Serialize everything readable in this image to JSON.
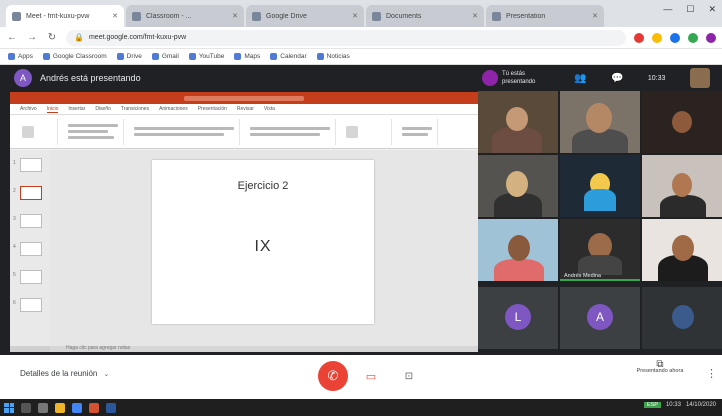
{
  "browser": {
    "tabs": [
      {
        "title": "Meet - fmt-kuxu-pvw",
        "active": true
      },
      {
        "title": "Classroom - ...",
        "active": false
      },
      {
        "title": "Google Drive",
        "active": false
      },
      {
        "title": "Documents",
        "active": false
      },
      {
        "title": "Presentation",
        "active": false
      }
    ],
    "window_controls": {
      "minimize": "—",
      "maximize": "☐",
      "close": "✕"
    },
    "nav": {
      "back": "←",
      "forward": "→",
      "reload": "↻"
    },
    "url": "meet.google.com/fmt-kuxu-pvw",
    "bookmarks": [
      "Apps",
      "Google Classroom",
      "Drive",
      "Gmail",
      "YouTube",
      "Maps",
      "Calendar",
      "Noticias"
    ]
  },
  "meet": {
    "presenter": {
      "initial": "A",
      "title": "Andrés está presentando"
    },
    "self_view": {
      "line1": "Tú estás",
      "line2": "presentando"
    },
    "top_icons": {
      "people": "👥",
      "chat": "💬",
      "time_label": "10:33"
    },
    "presentation": {
      "ribbon_tabs": [
        "Archivo",
        "Inicio",
        "Insertar",
        "Diseño",
        "Transiciones",
        "Animaciones",
        "Presentación",
        "Revisar",
        "Vista"
      ],
      "slide_numbers": [
        "1",
        "2",
        "3",
        "4",
        "5",
        "6"
      ],
      "slide_title": "Ejercicio 2",
      "slide_body": "IX",
      "notes_label": "Haga clic para agregar notas"
    },
    "participants": [
      {
        "label": "",
        "type": "video"
      },
      {
        "label": "",
        "type": "video"
      },
      {
        "label": "",
        "type": "video"
      },
      {
        "label": "",
        "type": "video"
      },
      {
        "label": "",
        "type": "video"
      },
      {
        "label": "",
        "type": "video"
      },
      {
        "label": "",
        "type": "video"
      },
      {
        "label": "Andrés Medina",
        "type": "video",
        "speaking": true
      },
      {
        "label": "",
        "type": "video"
      },
      {
        "label": "",
        "type": "avatar",
        "initial": "L"
      },
      {
        "label": "",
        "type": "avatar",
        "initial": "A"
      },
      {
        "label": "",
        "type": "video"
      }
    ]
  },
  "controls": {
    "details_label": "Detalles de la reunión",
    "details_chevron": "⌄",
    "end_call_icon": "✆",
    "camera_icon": "▭",
    "captions_icon": "⊡",
    "presenting_icon": "⧉",
    "presenting_label": "Presentando ahora",
    "more_icon": "⋮"
  },
  "taskbar": {
    "tray_badge": "ESP",
    "time": "10:33",
    "date": "14/10/2020"
  },
  "colors": {
    "meet_bg": "#202124",
    "end_call": "#ea4335",
    "ppt_accent": "#c43e1c",
    "speaking": "#34a853"
  }
}
